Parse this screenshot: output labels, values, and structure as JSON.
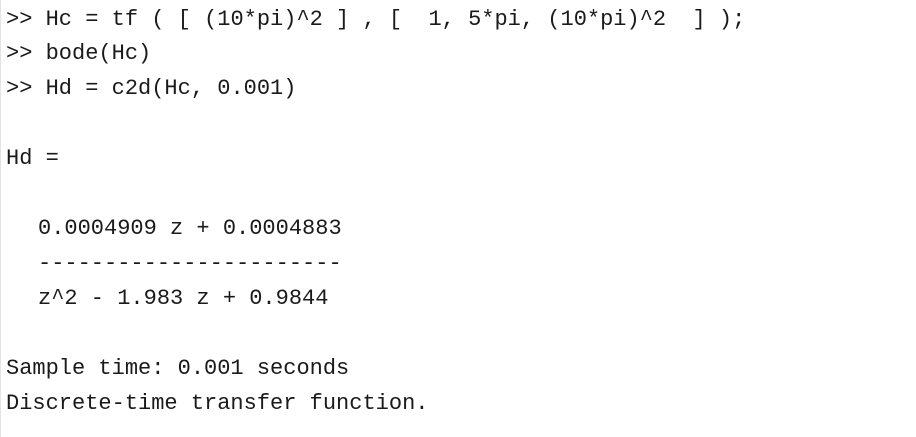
{
  "console": {
    "prompt": ">>",
    "commands": [
      " Hc = tf ( [ (10*pi)^2 ] , [  1, 5*pi, (10*pi)^2  ] );",
      " bode(Hc)",
      " Hd = c2d(Hc, 0.001)"
    ],
    "output": {
      "var_header": "Hd =",
      "numerator": "0.0004909 z + 0.0004883",
      "fraction_bar": "-----------------------",
      "denominator": "z^2 - 1.983 z + 0.9844",
      "sample_time": "Sample time: 0.001 seconds",
      "description": "Discrete-time transfer function."
    }
  }
}
